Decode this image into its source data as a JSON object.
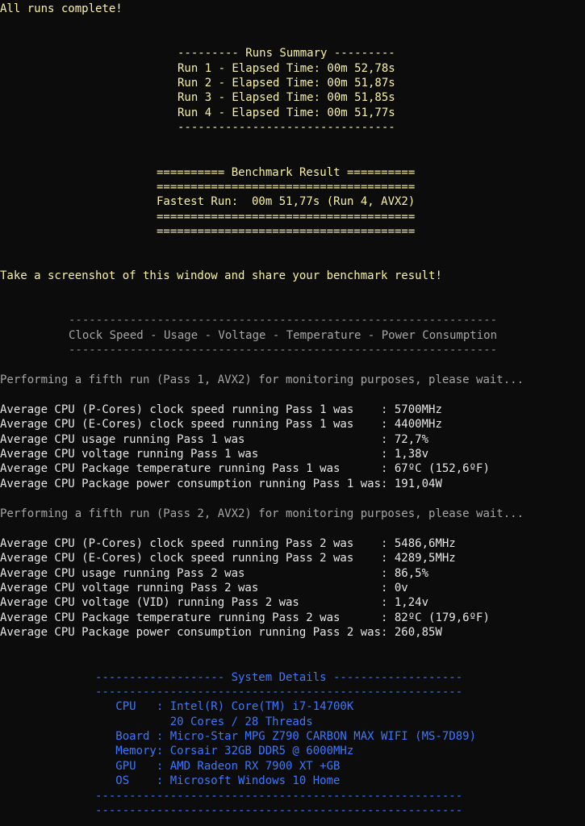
{
  "header": {
    "complete": "All runs complete!"
  },
  "runs_summary": {
    "top_rule": "--------- Runs Summary ---------",
    "runs": [
      "Run 1 - Elapsed Time: 00m 52,78s",
      "Run 2 - Elapsed Time: 00m 51,87s",
      "Run 3 - Elapsed Time: 00m 51,85s",
      "Run 4 - Elapsed Time: 00m 51,77s"
    ],
    "bottom_rule": "--------------------------------"
  },
  "benchmark": {
    "title_rule": "========== Benchmark Result ==========",
    "rule": "======================================",
    "fastest": "Fastest Run:  00m 51,77s (Run 4, AVX2)"
  },
  "share_message": "Take a screenshot of this window and share your benchmark result!",
  "monitoring": {
    "rule": "---------------------------------------------------------------",
    "heading": "Clock Speed - Usage - Voltage - Temperature - Power Consumption"
  },
  "pass1": {
    "status": "Performing a fifth run (Pass 1, AVX2) for monitoring purposes, please wait...",
    "lines": [
      "Average CPU (P-Cores) clock speed running Pass 1 was    : 5700MHz",
      "Average CPU (E-Cores) clock speed running Pass 1 was    : 4400MHz",
      "Average CPU usage running Pass 1 was                    : 72,7%",
      "Average CPU voltage running Pass 1 was                  : 1,38v",
      "Average CPU Package temperature running Pass 1 was      : 67ºC (152,6ºF)",
      "Average CPU Package power consumption running Pass 1 was: 191,04W"
    ]
  },
  "pass2": {
    "status": "Performing a fifth run (Pass 2, AVX2) for monitoring purposes, please wait...",
    "lines": [
      "Average CPU (P-Cores) clock speed running Pass 2 was    : 5486,6MHz",
      "Average CPU (E-Cores) clock speed running Pass 2 was    : 4289,5MHz",
      "Average CPU usage running Pass 2 was                    : 86,5%",
      "Average CPU voltage running Pass 2 was                  : 0v",
      "Average CPU voltage (VID) running Pass 2 was            : 1,24v",
      "Average CPU Package temperature running Pass 2 was      : 82ºC (179,6ºF)",
      "Average CPU Package power consumption running Pass 2 was: 260,85W"
    ]
  },
  "system_details": {
    "title_rule": "------------------- System Details -------------------",
    "rule": "------------------------------------------------------",
    "rows": [
      "   CPU   : Intel(R) Core(TM) i7-14700K",
      "           20 Cores / 28 Threads",
      "   Board : Micro-Star MPG Z790 CARBON MAX WIFI (MS-7D89)",
      "   Memory: Corsair 32GB DDR5 @ 6000MHz",
      "   GPU   : AMD Radeon RX 7900 XT +GB",
      "   OS    : Microsoft Windows 10 Home"
    ]
  },
  "colors": {
    "background": "#0c0c0c",
    "yellow": "#f9f1a5",
    "gray": "#a6a6a6",
    "white": "#e6e6e6",
    "blue": "#3b78ff"
  }
}
